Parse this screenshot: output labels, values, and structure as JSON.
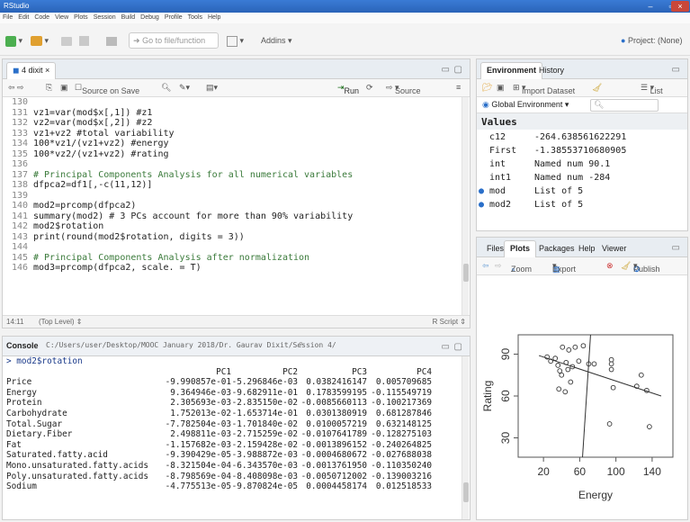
{
  "app": {
    "title": "RStudio",
    "menu": [
      "File",
      "Edit",
      "Code",
      "View",
      "Plots",
      "Session",
      "Build",
      "Debug",
      "Profile",
      "Tools",
      "Help"
    ],
    "goto_placeholder": "Go to file/function",
    "addins_label": "Addins",
    "project_label": "Project: (None)"
  },
  "editor": {
    "tab_label": "4 dixit",
    "source_on_save": "Source on Save",
    "run_label": "Run",
    "source_label": "Source",
    "cursor_pos": "14:11",
    "scope": "(Top Level)",
    "file_type": "R Script",
    "lines": [
      {
        "n": "130",
        "code": ""
      },
      {
        "n": "131",
        "code": "vz1=var(mod$x[,1]) #z1"
      },
      {
        "n": "132",
        "code": "vz2=var(mod$x[,2]) #z2"
      },
      {
        "n": "133",
        "code": "vz1+vz2 #total variability"
      },
      {
        "n": "134",
        "code": "100*vz1/(vz1+vz2) #energy"
      },
      {
        "n": "135",
        "code": "100*vz2/(vz1+vz2) #rating"
      },
      {
        "n": "136",
        "code": ""
      },
      {
        "n": "137",
        "code": "# Principal Components Analysis for all numerical variables"
      },
      {
        "n": "138",
        "code": "dfpca2=df1[,-c(11,12)]"
      },
      {
        "n": "139",
        "code": ""
      },
      {
        "n": "140",
        "code": "mod2=prcomp(dfpca2)"
      },
      {
        "n": "141",
        "code": "summary(mod2) # 3 PCs account for more than 90% variability"
      },
      {
        "n": "142",
        "code": "mod2$rotation"
      },
      {
        "n": "143",
        "code": "print(round(mod2$rotation, digits = 3))"
      },
      {
        "n": "144",
        "code": ""
      },
      {
        "n": "145",
        "code": "# Principal Components Analysis after normalization"
      },
      {
        "n": "146",
        "code": "mod3=prcomp(dfpca2, scale. = T)"
      }
    ]
  },
  "console": {
    "title": "Console",
    "path": "C:/Users/user/Desktop/MOOC January 2018/Dr. Gaurav Dixit/Session 4/",
    "prompt_line": "> mod2$rotation",
    "headers": [
      "PC1",
      "PC2",
      "PC3",
      "PC4"
    ],
    "rows": [
      {
        "name": "Price",
        "v": [
          "-9.990857e-01",
          "-5.296846e-03",
          "0.0382416147",
          "0.005709685"
        ]
      },
      {
        "name": "Energy",
        "v": [
          "9.364946e-03",
          "-9.682911e-01",
          "0.1783599195",
          "-0.115549719"
        ]
      },
      {
        "name": "Protein",
        "v": [
          "2.305693e-03",
          "-2.835150e-02",
          "-0.0085660113",
          "-0.100217369"
        ]
      },
      {
        "name": "Carbohydrate",
        "v": [
          "1.752013e-02",
          "-1.653714e-01",
          "0.0301380919",
          "0.681287846"
        ]
      },
      {
        "name": "Total.Sugar",
        "v": [
          "-7.782504e-03",
          "-1.701840e-02",
          "0.0100057219",
          "0.632148125"
        ]
      },
      {
        "name": "Dietary.Fiber",
        "v": [
          "2.498811e-03",
          "-2.715259e-02",
          "-0.0107641789",
          "-0.128275103"
        ]
      },
      {
        "name": "Fat",
        "v": [
          "-1.157682e-03",
          "-2.159428e-02",
          "-0.0013896152",
          "-0.240264825"
        ]
      },
      {
        "name": "Saturated.fatty.acid",
        "v": [
          "-9.390429e-05",
          "-3.988872e-03",
          "-0.0004680672",
          "-0.027688038"
        ]
      },
      {
        "name": "Mono.unsaturated.fatty.acids",
        "v": [
          "-8.321504e-04",
          "-6.343570e-03",
          "-0.0013761950",
          "-0.110350240"
        ]
      },
      {
        "name": "Poly.unsaturated.fatty.acids",
        "v": [
          "-8.798569e-04",
          "-8.408098e-03",
          "-0.0050712002",
          "-0.139003216"
        ]
      },
      {
        "name": "Sodium",
        "v": [
          "-4.775513e-05",
          "-9.870824e-05",
          "0.0004458174",
          "0.012518533"
        ]
      }
    ]
  },
  "environment": {
    "tabs": [
      "Environment",
      "History"
    ],
    "import_label": "Import Dataset",
    "list_label": "List",
    "scope": "Global Environment",
    "section": "Values",
    "items": [
      {
        "name": "c12",
        "value": "-264.638561622291",
        "icon": false
      },
      {
        "name": "First",
        "value": "-1.38553710680905",
        "icon": false
      },
      {
        "name": "int",
        "value": "Named num 90.1",
        "icon": false
      },
      {
        "name": "int1",
        "value": "Named num -284",
        "icon": false
      },
      {
        "name": "mod",
        "value": "List of 5",
        "icon": true
      },
      {
        "name": "mod2",
        "value": "List of 5",
        "icon": true
      }
    ]
  },
  "plots": {
    "tabs": [
      "Files",
      "Plots",
      "Packages",
      "Help",
      "Viewer"
    ],
    "zoom_label": "Zoom",
    "export_label": "Export",
    "publish_label": "Publish"
  },
  "chart_data": {
    "type": "scatter",
    "xlabel": "Energy",
    "ylabel": "Rating",
    "x_ticks": [
      20,
      60,
      100,
      140
    ],
    "y_ticks": [
      30,
      60,
      90
    ],
    "xlim": [
      0,
      155
    ],
    "ylim": [
      20,
      100
    ],
    "points": [
      [
        24,
        88
      ],
      [
        28,
        85
      ],
      [
        33,
        87
      ],
      [
        36,
        82
      ],
      [
        41,
        95
      ],
      [
        45,
        84
      ],
      [
        48,
        93
      ],
      [
        40,
        75
      ],
      [
        37,
        65
      ],
      [
        44,
        63
      ],
      [
        52,
        81
      ],
      [
        38,
        78
      ],
      [
        55,
        95
      ],
      [
        47,
        79
      ],
      [
        64,
        96
      ],
      [
        70,
        83
      ],
      [
        76,
        83
      ],
      [
        95,
        83
      ],
      [
        95,
        86
      ],
      [
        95,
        79
      ],
      [
        97,
        66
      ],
      [
        128,
        75
      ],
      [
        134,
        64
      ],
      [
        123,
        67
      ],
      [
        93,
        40
      ],
      [
        137,
        38
      ],
      [
        59,
        85
      ],
      [
        50,
        70
      ]
    ],
    "fit_lines": [
      {
        "x1": 15,
        "y1": 89,
        "x2": 150,
        "y2": 60
      },
      {
        "x1": 63,
        "y1": 15,
        "x2": 72,
        "y2": 104
      }
    ]
  }
}
